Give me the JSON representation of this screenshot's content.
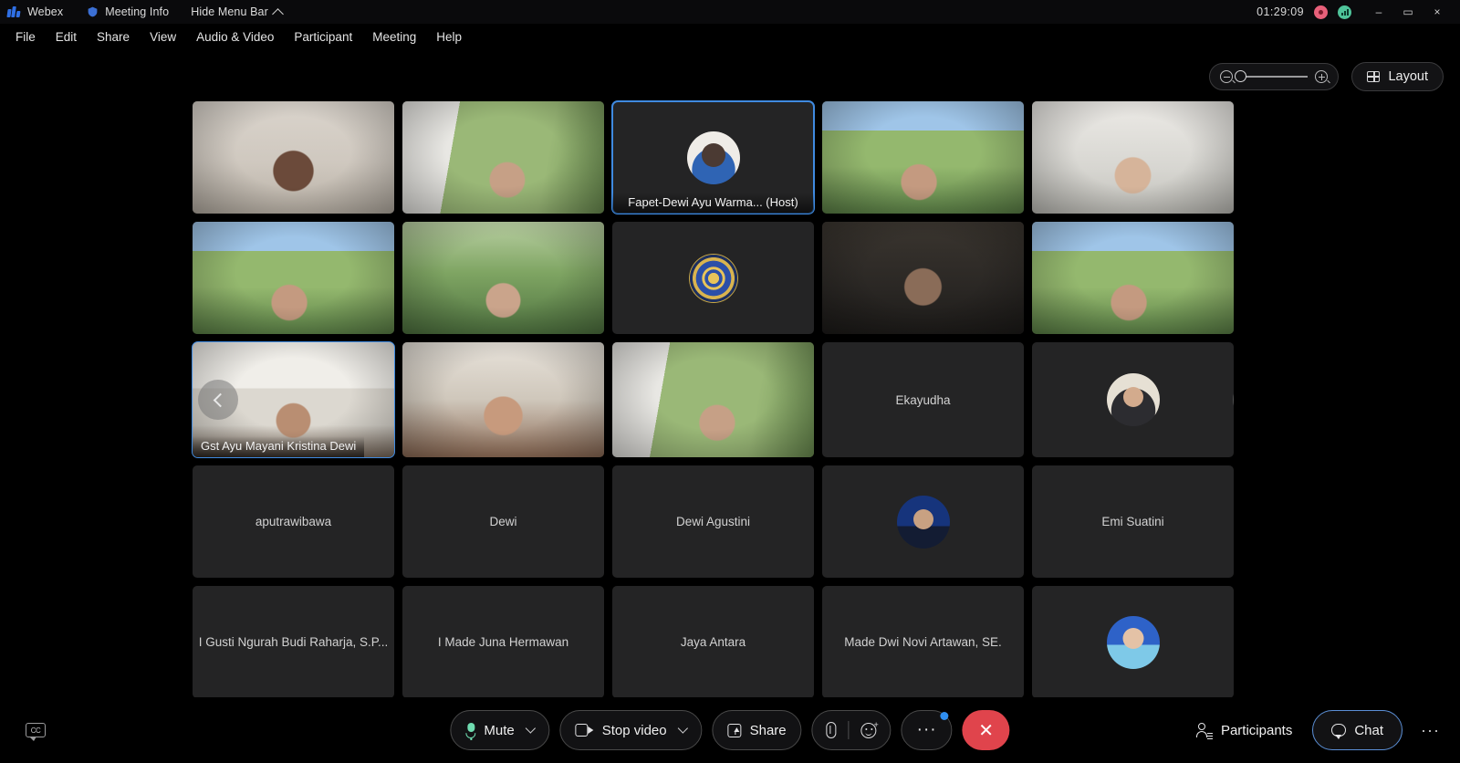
{
  "app": {
    "name": "Webex",
    "meeting_info_label": "Meeting Info",
    "hide_menu_bar_label": "Hide Menu Bar",
    "timer": "01:29:09",
    "accent_color": "#3f8ae0",
    "record_color": "#e8607a",
    "signal_color": "#4fc49a",
    "end_call_color": "#e0444c"
  },
  "window_controls": {
    "minimize": "–",
    "maximize": "▭",
    "close": "×"
  },
  "menubar": {
    "items": [
      {
        "label": "File"
      },
      {
        "label": "Edit"
      },
      {
        "label": "Share"
      },
      {
        "label": "View"
      },
      {
        "label": "Audio & Video"
      },
      {
        "label": "Participant"
      },
      {
        "label": "Meeting"
      },
      {
        "label": "Help"
      }
    ]
  },
  "top_controls": {
    "zoom_out_icon": "magnifier-minus-icon",
    "zoom_in_icon": "magnifier-plus-icon",
    "zoom_value": 0,
    "layout_label": "Layout"
  },
  "grid": {
    "rows": [
      [
        {
          "kind": "video",
          "scene": "sc-office",
          "name": "",
          "label_pos": "none"
        },
        {
          "kind": "video",
          "scene": "sc-trees",
          "name": "",
          "label_pos": "none"
        },
        {
          "kind": "avatar",
          "avatar": "av-host",
          "name": "Fapet-Dewi Ayu Warma... (Host)",
          "label_pos": "center-bottom",
          "active": true
        },
        {
          "kind": "video",
          "scene": "sc-campus",
          "name": "",
          "label_pos": "none"
        },
        {
          "kind": "video",
          "scene": "sc-room",
          "name": "",
          "label_pos": "none"
        }
      ],
      [
        {
          "kind": "video",
          "scene": "sc-campus",
          "name": "",
          "label_pos": "none"
        },
        {
          "kind": "video",
          "scene": "sc-garden",
          "name": "",
          "label_pos": "none"
        },
        {
          "kind": "emblem",
          "name": "",
          "label_pos": "none"
        },
        {
          "kind": "video",
          "scene": "sc-dark",
          "name": "",
          "label_pos": "none"
        },
        {
          "kind": "video",
          "scene": "sc-campus",
          "name": "",
          "label_pos": "none"
        }
      ],
      [
        {
          "kind": "video",
          "scene": "sc-hall",
          "name": "Gst Ayu Mayani Kristina Dewi",
          "label_pos": "bottom-left",
          "active": true,
          "page_prev": true
        },
        {
          "kind": "video",
          "scene": "sc-portrait",
          "name": "",
          "label_pos": "none"
        },
        {
          "kind": "video",
          "scene": "sc-trees",
          "name": "",
          "label_pos": "none"
        },
        {
          "kind": "name",
          "name": "Ekayudha",
          "label_pos": "center"
        },
        {
          "kind": "avatar",
          "avatar": "av-photo",
          "name": "",
          "label_pos": "none",
          "page_next": true
        }
      ],
      [
        {
          "kind": "name",
          "name": "aputrawibawa",
          "label_pos": "center"
        },
        {
          "kind": "name",
          "name": "Dewi",
          "label_pos": "center"
        },
        {
          "kind": "name",
          "name": "Dewi Agustini",
          "label_pos": "center"
        },
        {
          "kind": "avatar",
          "avatar": "av-blue",
          "name": "",
          "label_pos": "none"
        },
        {
          "kind": "name",
          "name": "Emi Suatini",
          "label_pos": "center"
        }
      ],
      [
        {
          "kind": "name",
          "name": "I Gusti Ngurah Budi Raharja, S.P...",
          "label_pos": "center"
        },
        {
          "kind": "name",
          "name": "I Made Juna Hermawan",
          "label_pos": "center"
        },
        {
          "kind": "name",
          "name": "Jaya Antara",
          "label_pos": "center"
        },
        {
          "kind": "name",
          "name": "Made Dwi Novi Artawan, SE.",
          "label_pos": "center"
        },
        {
          "kind": "avatar",
          "avatar": "av-cyan",
          "name": "",
          "label_pos": "none"
        }
      ]
    ]
  },
  "toolbar": {
    "captions_icon": "closed-caption-icon",
    "mute_label": "Mute",
    "stop_video_label": "Stop video",
    "share_label": "Share",
    "attach_icon": "paperclip-icon",
    "reactions_icon": "smiley-plus-icon",
    "more_label": "···",
    "end_call_icon": "close-icon",
    "participants_label": "Participants",
    "chat_label": "Chat",
    "overflow_label": "···"
  }
}
